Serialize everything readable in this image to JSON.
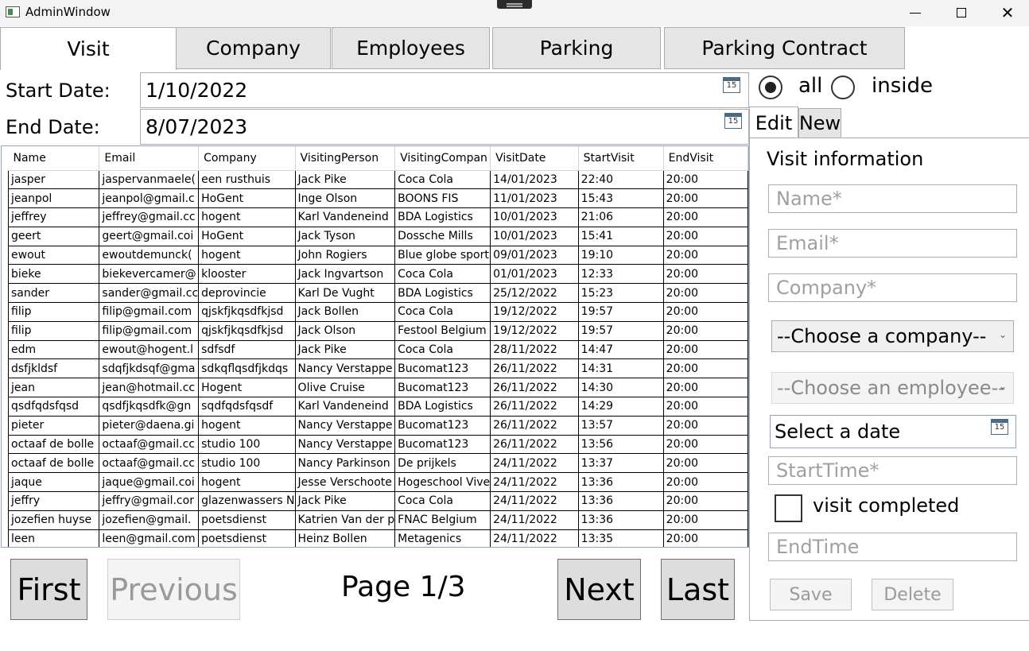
{
  "window": {
    "title": "AdminWindow",
    "minimize_glyph": "",
    "close_glyph": "✕"
  },
  "main_tabs": [
    {
      "label": "Visit",
      "active": true
    },
    {
      "label": "Company",
      "active": false
    },
    {
      "label": "Employees",
      "active": false
    },
    {
      "label": "Parking",
      "active": false
    },
    {
      "label": "Parking Contract",
      "active": false
    }
  ],
  "filters": {
    "start_label": "Start Date:",
    "start_value": "1/10/2022",
    "end_label": "End Date:",
    "end_value": "8/07/2023",
    "calendar_day": "15",
    "radio_all": "all",
    "radio_inside": "inside",
    "selected": "all"
  },
  "grid": {
    "columns": [
      "Name",
      "Email",
      "Company",
      "VisitingPerson",
      "VisitingCompan",
      "VisitDate",
      "StartVisit",
      "EndVisit"
    ],
    "rows": [
      [
        "jasper",
        "jaspervanmaele(",
        "een rusthuis",
        "Jack Pike",
        "Coca Cola",
        "14/01/2023",
        "22:40",
        "20:00"
      ],
      [
        "jeanpol",
        "jeanpol@gmail.c",
        "HoGent",
        "Inge Olson",
        "BOONS FIS",
        "11/01/2023",
        "15:43",
        "20:00"
      ],
      [
        "jeffrey",
        "jeffrey@gmail.cc",
        "hogent",
        "Karl Vandeneind",
        "BDA Logistics",
        "10/01/2023",
        "21:06",
        "20:00"
      ],
      [
        "geert",
        "geert@gmail.coi",
        "HoGent",
        "Jack Tyson",
        "Dossche Mills",
        "10/01/2023",
        "15:41",
        "20:00"
      ],
      [
        "ewout",
        "ewoutdemunck(",
        "hogent",
        "John Rogiers",
        "Blue globe sport",
        "09/01/2023",
        "19:10",
        "20:00"
      ],
      [
        "bieke",
        "biekevercamer@",
        "klooster",
        "Jack Ingvartson",
        "Coca Cola",
        "01/01/2023",
        "12:33",
        "20:00"
      ],
      [
        "sander",
        "sander@gmail.cc",
        "deprovincie",
        "Karl De Vught",
        "BDA Logistics",
        "25/12/2022",
        "15:23",
        "20:00"
      ],
      [
        "filip",
        "filip@gmail.com",
        "qjskfjkqsdfkjsd",
        "Jack Bollen",
        "Coca Cola",
        "19/12/2022",
        "19:57",
        "20:00"
      ],
      [
        "filip",
        "filip@gmail.com",
        "qjskfjkqsdfkjsd",
        "Jack Olson",
        "Festool Belgium",
        "19/12/2022",
        "19:57",
        "20:00"
      ],
      [
        "edm",
        "ewout@hogent.l",
        "sdfsdf",
        "Jack Pike",
        "Coca Cola",
        "28/11/2022",
        "14:47",
        "20:00"
      ],
      [
        "dsfjkldsf",
        "sdqfjkdsqf@gma",
        "sdkqflqsdfjkdqs",
        "Nancy Verstappe",
        "Bucomat123",
        "26/11/2022",
        "14:31",
        "20:00"
      ],
      [
        "jean",
        "jean@hotmail.cc",
        "Hogent",
        "Olive Cruise",
        "Bucomat123",
        "26/11/2022",
        "14:30",
        "20:00"
      ],
      [
        "qsdfqdsfqsd",
        "qsdfjkqsdfk@gn",
        "sqdfqdsfqsdf",
        "Karl Vandeneind",
        "BDA Logistics",
        "26/11/2022",
        "14:29",
        "20:00"
      ],
      [
        "pieter",
        "pieter@daena.gi",
        "hogent",
        "Nancy Verstappe",
        "Bucomat123",
        "26/11/2022",
        "13:57",
        "20:00"
      ],
      [
        "octaaf de bolle",
        "octaaf@gmail.cc",
        "studio 100",
        "Nancy Verstappe",
        "Bucomat123",
        "26/11/2022",
        "13:56",
        "20:00"
      ],
      [
        "octaaf de bolle",
        "octaaf@gmail.cc",
        "studio 100",
        "Nancy Parkinson",
        "De prijkels",
        "24/11/2022",
        "13:37",
        "20:00"
      ],
      [
        "jaque",
        "jaque@gmail.coi",
        "hogent",
        "Jesse Verschoote",
        "Hogeschool Vive",
        "24/11/2022",
        "13:36",
        "20:00"
      ],
      [
        "jeffry",
        "jeffry@gmail.cor",
        "glazenwassers N",
        "Jack Pike",
        "Coca Cola",
        "24/11/2022",
        "13:36",
        "20:00"
      ],
      [
        "jozefien huyse",
        "jozefien@gmail.",
        "poetsdienst",
        "Katrien Van der p",
        "FNAC Belgium",
        "24/11/2022",
        "13:36",
        "20:00"
      ],
      [
        "leen",
        "leen@gmail.com",
        "poetsdienst",
        "Heinz Bollen",
        "Metagenics",
        "24/11/2022",
        "13:35",
        "20:00"
      ]
    ]
  },
  "pager": {
    "first": "First",
    "previous": "Previous",
    "page_text": "Page 1/3",
    "next": "Next",
    "last": "Last"
  },
  "side_tabs": [
    {
      "label": "Edit",
      "active": true
    },
    {
      "label": "New",
      "active": false
    }
  ],
  "visit_form": {
    "title": "Visit information",
    "name_placeholder": "Name*",
    "email_placeholder": "Email*",
    "company_placeholder": "Company*",
    "company_combo": "--Choose a company--",
    "employee_combo": "--Choose an employee--",
    "date_placeholder": "Select a date",
    "start_time_placeholder": "StartTime*",
    "completed_label": "visit completed",
    "end_time_placeholder": "EndTime",
    "save": "Save",
    "delete": "Delete"
  }
}
